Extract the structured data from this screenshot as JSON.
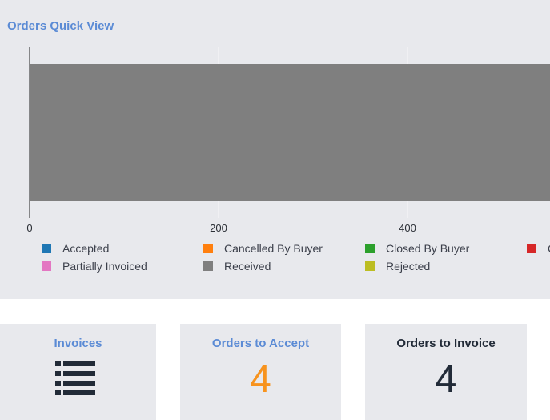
{
  "panel": {
    "title": "Orders Quick View"
  },
  "chart_data": {
    "type": "bar",
    "orientation": "horizontal",
    "categories": [
      ""
    ],
    "series": [
      {
        "name": "Received",
        "values": [
          560
        ],
        "color": "#7f7f7f"
      }
    ],
    "xlim": [
      0,
      560
    ],
    "xticks": [
      0,
      200,
      400
    ],
    "xlabel": "",
    "ylabel": "",
    "grid": true,
    "legend_placement": "bottom",
    "legend": [
      {
        "label": "Accepted",
        "color": "#1f77b4"
      },
      {
        "label": "Cancelled By Buyer",
        "color": "#ff7f0e"
      },
      {
        "label": "Closed By Buyer",
        "color": "#2ca02c"
      },
      {
        "label": "C",
        "color": "#d62728"
      },
      {
        "label": "Partially Invoiced",
        "color": "#e377c2"
      },
      {
        "label": "Received",
        "color": "#7f7f7f"
      },
      {
        "label": "Rejected",
        "color": "#bcbd22"
      }
    ]
  },
  "cards": [
    {
      "title": "Invoices",
      "icon": "list-icon",
      "title_color": "#5b8bd5"
    },
    {
      "title": "Orders to Accept",
      "value": "4",
      "title_color": "#5b8bd5",
      "value_color": "#f7931e"
    },
    {
      "title": "Orders to Invoice",
      "value": "4",
      "title_color": "#222b38",
      "value_color": "#222b38"
    }
  ]
}
